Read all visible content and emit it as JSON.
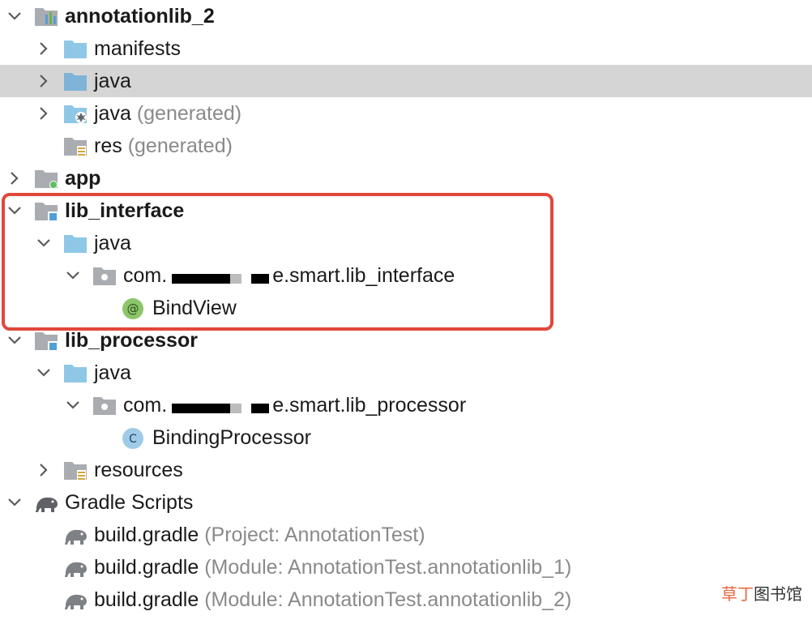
{
  "tree": {
    "items": [
      {
        "name": "annotationlib_2"
      },
      {
        "name": "manifests"
      },
      {
        "name": "java"
      },
      {
        "name": "java",
        "suffix": "(generated)"
      },
      {
        "name": "res",
        "suffix": "(generated)"
      },
      {
        "name": "app"
      },
      {
        "name": "lib_interface"
      },
      {
        "name": "java"
      },
      {
        "name": "com.",
        "tail": "e.smart.lib_interface"
      },
      {
        "name": "BindView"
      },
      {
        "name": "lib_processor"
      },
      {
        "name": "java"
      },
      {
        "name": "com.",
        "tail": "e.smart.lib_processor"
      },
      {
        "name": "BindingProcessor"
      },
      {
        "name": "resources"
      },
      {
        "name": "Gradle Scripts"
      },
      {
        "name": "build.gradle",
        "suffix": "(Project: AnnotationTest)"
      },
      {
        "name": "build.gradle",
        "suffix": "(Module: AnnotationTest.annotationlib_1)"
      },
      {
        "name": "build.gradle",
        "suffix": "(Module: AnnotationTest.annotationlib_2)"
      }
    ]
  },
  "watermark": {
    "part1": "草丁",
    "part2": "图书馆"
  },
  "colors": {
    "selection": "#d5d5d5",
    "folder_blue": "#8fc7e6",
    "folder_gray": "#a9acb0",
    "highlight_border": "#e0483b",
    "annotation_badge": "#8cc56a",
    "class_badge": "#9fcbe8"
  }
}
